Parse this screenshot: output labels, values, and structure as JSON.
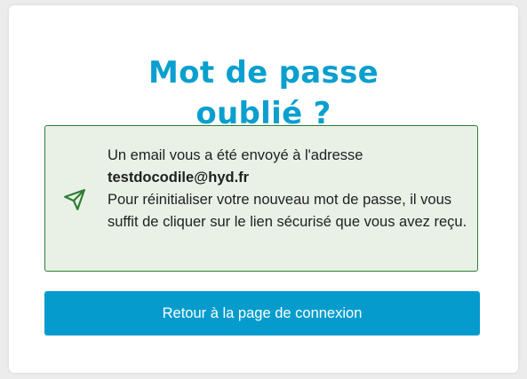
{
  "page": {
    "title_line1": "Mot de passe",
    "title_line2": "oublié ?"
  },
  "alert": {
    "icon": "paper-plane-icon",
    "line1": "Un email vous a été envoyé à l'adresse",
    "email": "testdocodile@hyd.fr",
    "message": "Pour réinitialiser votre nouveau mot de passe, il vous suffit de cliquer sur le lien sécurisé que vous avez reçu."
  },
  "actions": {
    "back_label": "Retour à la page de connexion"
  },
  "colors": {
    "brand": "#0a9fce",
    "button": "#059ccd",
    "success_border": "#2f7d32",
    "success_bg": "#e9f1e7"
  }
}
